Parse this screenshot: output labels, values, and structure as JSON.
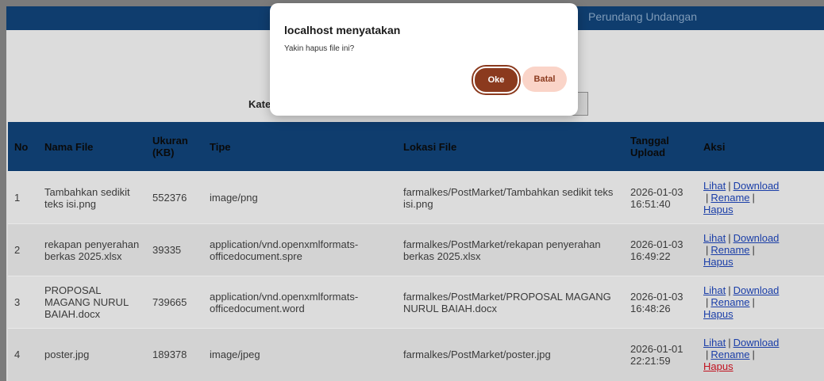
{
  "header": {
    "nav_text": "Perundang Undangan"
  },
  "filter": {
    "label": "Kategori",
    "select_value": "",
    "button_label": ""
  },
  "table": {
    "headers": [
      "No",
      "Nama File",
      "Ukuran (KB)",
      "Tipe",
      "Lokasi File",
      "Tanggal Upload",
      "Aksi"
    ],
    "rows": [
      {
        "no": "1",
        "name": "Tambahkan sedikit teks isi.png",
        "size": "552376",
        "type": "image/png",
        "path": "farmalkes/PostMarket/Tambahkan sedikit teks isi.png",
        "date": "2026-01-03 16:51:40"
      },
      {
        "no": "2",
        "name": "rekapan penyerahan berkas 2025.xlsx",
        "size": "39335",
        "type": "application/vnd.openxmlformats-officedocument.spre",
        "path": "farmalkes/PostMarket/rekapan penyerahan berkas 2025.xlsx",
        "date": "2026-01-03 16:49:22"
      },
      {
        "no": "3",
        "name": "PROPOSAL MAGANG NURUL BAIAH.docx",
        "size": "739665",
        "type": "application/vnd.openxmlformats-officedocument.word",
        "path": "farmalkes/PostMarket/PROPOSAL MAGANG NURUL BAIAH.docx",
        "date": "2026-01-03 16:48:26"
      },
      {
        "no": "4",
        "name": "poster.jpg",
        "size": "189378",
        "type": "image/jpeg",
        "path": "farmalkes/PostMarket/poster.jpg",
        "date": "2026-01-01 22:21:59"
      }
    ],
    "actions": {
      "view": "Lihat",
      "download": "Download",
      "rename": "Rename",
      "delete": "Hapus",
      "separator": "|"
    }
  },
  "dialog": {
    "title": "localhost menyatakan",
    "message": "Yakin hapus file ini?",
    "ok_label": "Oke",
    "cancel_label": "Batal"
  }
}
